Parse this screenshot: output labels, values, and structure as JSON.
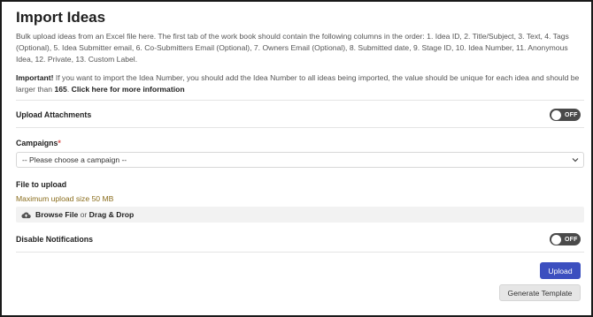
{
  "page": {
    "title": "Import Ideas",
    "description": "Bulk upload ideas from an Excel file here. The first tab of the work book should contain the following columns in the order: 1. Idea ID, 2. Title/Subject, 3. Text, 4. Tags (Optional), 5. Idea Submitter email, 6. Co-Submitters Email (Optional), 7. Owners Email (Optional), 8. Submitted date, 9. Stage ID, 10. Idea Number, 11. Anonymous Idea, 12. Private, 13. Custom Label.",
    "important_label": "Important!",
    "important_text": " If you want to import the Idea Number, you should add the Idea Number to all ideas being imported, the value should be unique for each idea and should be larger than ",
    "important_number": "165",
    "important_period": ".",
    "important_link": "Click here for more information"
  },
  "upload_attachments": {
    "label": "Upload Attachments",
    "toggle_text": "OFF",
    "state": "off"
  },
  "campaigns": {
    "label": "Campaigns",
    "required_mark": "*",
    "selected": "-- Please choose a campaign --"
  },
  "file_upload": {
    "label": "File to upload",
    "max_size": "Maximum upload size 50 MB",
    "browse": "Browse File",
    "or": " or ",
    "drag": "Drag & Drop",
    "icon": "cloud-upload-icon"
  },
  "disable_notifications": {
    "label": "Disable Notifications",
    "toggle_text": "OFF",
    "state": "off"
  },
  "actions": {
    "upload": "Upload",
    "generate_template": "Generate Template"
  },
  "colors": {
    "primary": "#3c4fbf",
    "toggle_bg": "#4a4a4a",
    "required": "#d9534f",
    "hint": "#8a6d1d"
  }
}
